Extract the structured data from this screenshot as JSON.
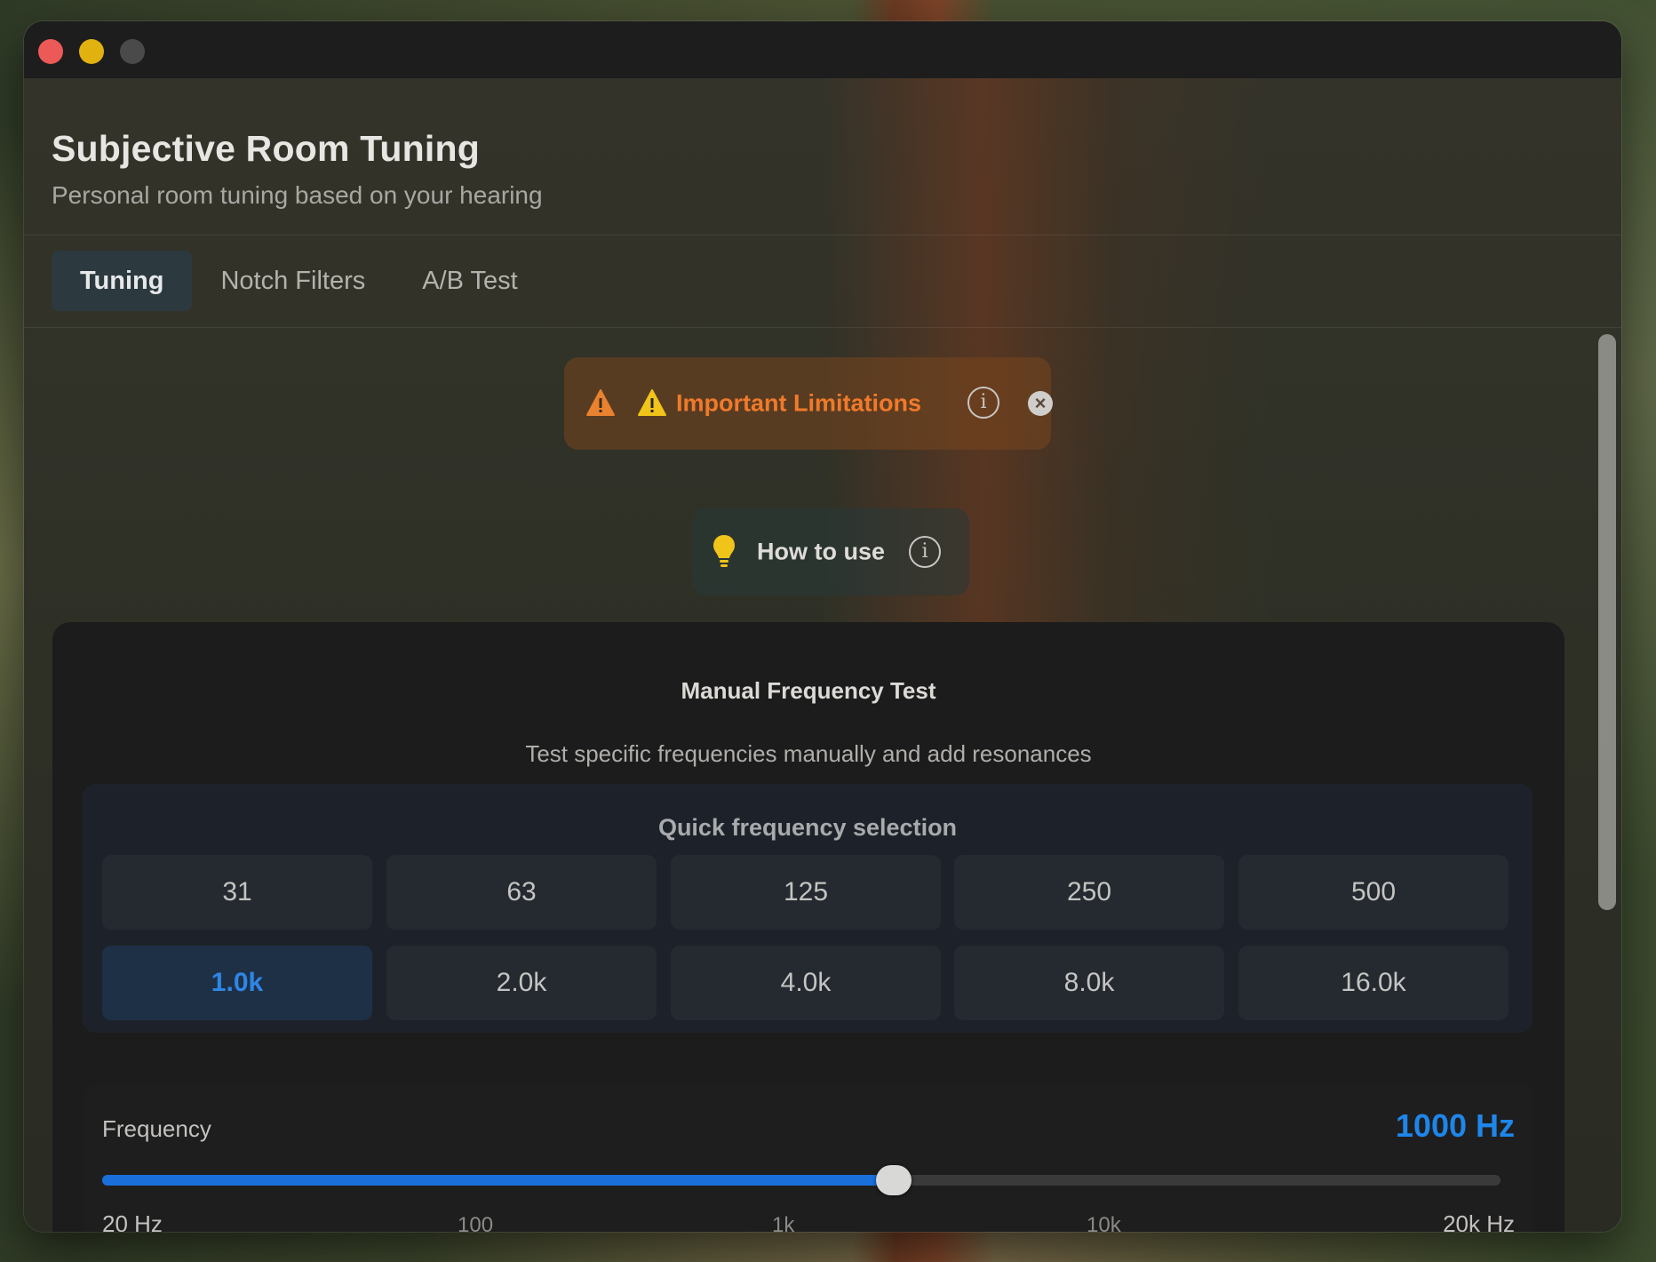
{
  "window": {
    "title": "Subjective Room Tuning",
    "subtitle": "Personal room tuning based on your hearing"
  },
  "tabs": [
    {
      "label": "Tuning",
      "active": true
    },
    {
      "label": "Notch Filters",
      "active": false
    },
    {
      "label": "A/B Test",
      "active": false
    }
  ],
  "warning": {
    "label": "Important Limitations",
    "icons": [
      "warning-triangle-icon",
      "warning-triangle-icon",
      "info-icon",
      "close-icon"
    ],
    "color": "#f07a2a"
  },
  "howto": {
    "label": "How to use",
    "icons": [
      "lightbulb-icon",
      "info-icon"
    ]
  },
  "manual_test": {
    "title": "Manual Frequency Test",
    "subtitle": "Test specific frequencies manually and add resonances",
    "quick_title": "Quick frequency selection",
    "presets": [
      "31",
      "63",
      "125",
      "250",
      "500",
      "1.0k",
      "2.0k",
      "4.0k",
      "8.0k",
      "16.0k"
    ],
    "selected": "1.0k",
    "accent": "#1e86ea"
  },
  "frequency": {
    "label": "Frequency",
    "value_text": "1000 Hz",
    "value_hz": 1000,
    "min_label": "20 Hz",
    "max_label": "20k Hz",
    "mid_ticks": [
      "100",
      "1k",
      "10k"
    ]
  }
}
